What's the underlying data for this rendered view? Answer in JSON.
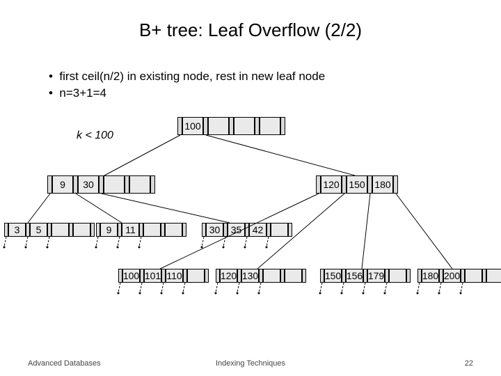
{
  "title": "B+ tree: Leaf Overflow (2/2)",
  "bullets": [
    "first ceil(n/2) in existing node, rest in new leaf node",
    "n=3+1=4"
  ],
  "annotation": "k < 100",
  "root": [
    "100",
    "",
    "",
    ""
  ],
  "internal_left": [
    "9",
    "30",
    "",
    ""
  ],
  "internal_right": [
    "120",
    "150",
    "180"
  ],
  "leaf1": [
    "3",
    "5",
    "",
    ""
  ],
  "leaf2": [
    "9",
    "11",
    "",
    ""
  ],
  "leaf3": [
    "30",
    "35",
    "42",
    ""
  ],
  "leaf4": [
    "100",
    "101",
    "110",
    ""
  ],
  "leaf5": [
    "120",
    "130",
    "",
    ""
  ],
  "leaf6": [
    "150",
    "156",
    "179",
    ""
  ],
  "leaf7": [
    "180",
    "200",
    "",
    ""
  ],
  "footer_left": "Advanced Databases",
  "footer_center": "Indexing Techniques",
  "footer_right": "22"
}
